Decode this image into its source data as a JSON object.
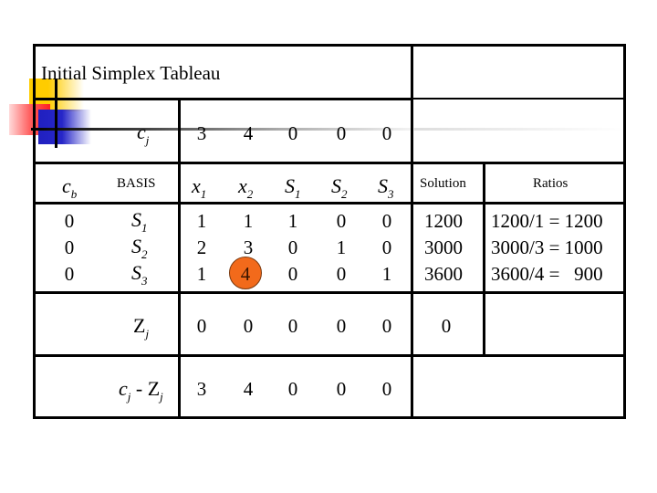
{
  "title": "Initial Simplex Tableau",
  "cj_row": {
    "label_main": "c",
    "label_sub": "j",
    "values": [
      "3",
      "4",
      "0",
      "0",
      "0"
    ]
  },
  "header_row": {
    "cb_main": "c",
    "cb_sub": "b",
    "basis": "BASIS",
    "columns": [
      {
        "main": "x",
        "sub": "1"
      },
      {
        "main": "x",
        "sub": "2"
      },
      {
        "main": "S",
        "sub": "1"
      },
      {
        "main": "S",
        "sub": "2"
      },
      {
        "main": "S",
        "sub": "3"
      }
    ],
    "solution": "Solution",
    "ratios": "Ratios"
  },
  "rows": [
    {
      "cb": "0",
      "basis_main": "S",
      "basis_sub": "1",
      "values": [
        "1",
        "1",
        "1",
        "0",
        "0"
      ],
      "solution": "1200",
      "ratio": "1200/1 = 1200"
    },
    {
      "cb": "0",
      "basis_main": "S",
      "basis_sub": "2",
      "values": [
        "2",
        "3",
        "0",
        "1",
        "0"
      ],
      "solution": "3000",
      "ratio": "3000/3 = 1000"
    },
    {
      "cb": "0",
      "basis_main": "S",
      "basis_sub": "3",
      "values": [
        "1",
        "4",
        "0",
        "0",
        "1"
      ],
      "solution": "3600",
      "ratio": "3600/4 =   900"
    }
  ],
  "pivot": {
    "row": 3,
    "column": "x2",
    "value": "4",
    "highlight_color": "#f26a1b"
  },
  "zj_row": {
    "label_main": "Z",
    "label_sub": "j",
    "values": [
      "0",
      "0",
      "0",
      "0",
      "0"
    ],
    "solution": "0"
  },
  "cj_minus_zj_row": {
    "label_c": "c",
    "label_c_sub": "j",
    "label_minus": " - ",
    "label_z": "Z",
    "label_z_sub": "j",
    "values": [
      "3",
      "4",
      "0",
      "0",
      "0"
    ]
  }
}
